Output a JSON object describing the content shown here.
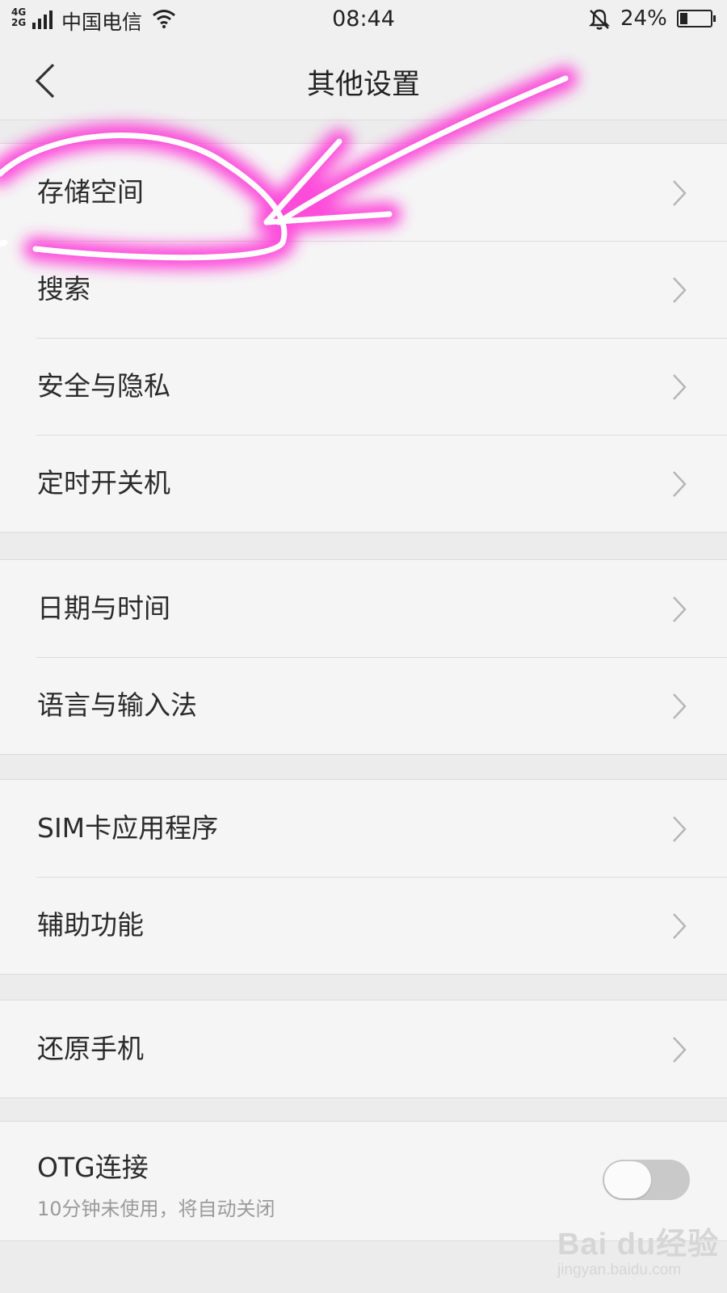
{
  "status_bar": {
    "network_top": "4G",
    "network_bottom": "2G",
    "carrier": "中国电信",
    "time": "08:44",
    "battery_percent_text": "24%",
    "battery_level": 0.24
  },
  "header": {
    "title": "其他设置"
  },
  "groups": [
    {
      "items": [
        {
          "label": "存储空间"
        },
        {
          "label": "搜索"
        },
        {
          "label": "安全与隐私"
        },
        {
          "label": "定时开关机"
        }
      ]
    },
    {
      "items": [
        {
          "label": "日期与时间"
        },
        {
          "label": "语言与输入法"
        }
      ]
    },
    {
      "items": [
        {
          "label": "SIM卡应用程序"
        },
        {
          "label": "辅助功能"
        }
      ]
    },
    {
      "items": [
        {
          "label": "还原手机"
        }
      ]
    }
  ],
  "otg": {
    "label": "OTG连接",
    "subtitle": "10分钟未使用，将自动关闭",
    "enabled": false
  },
  "watermark": {
    "brand": "Bai du经验",
    "url": "jingyan.baidu.com"
  },
  "colors": {
    "annotation": "#ff2fd6",
    "background": "#ececec",
    "row_background": "#f5f5f5"
  }
}
